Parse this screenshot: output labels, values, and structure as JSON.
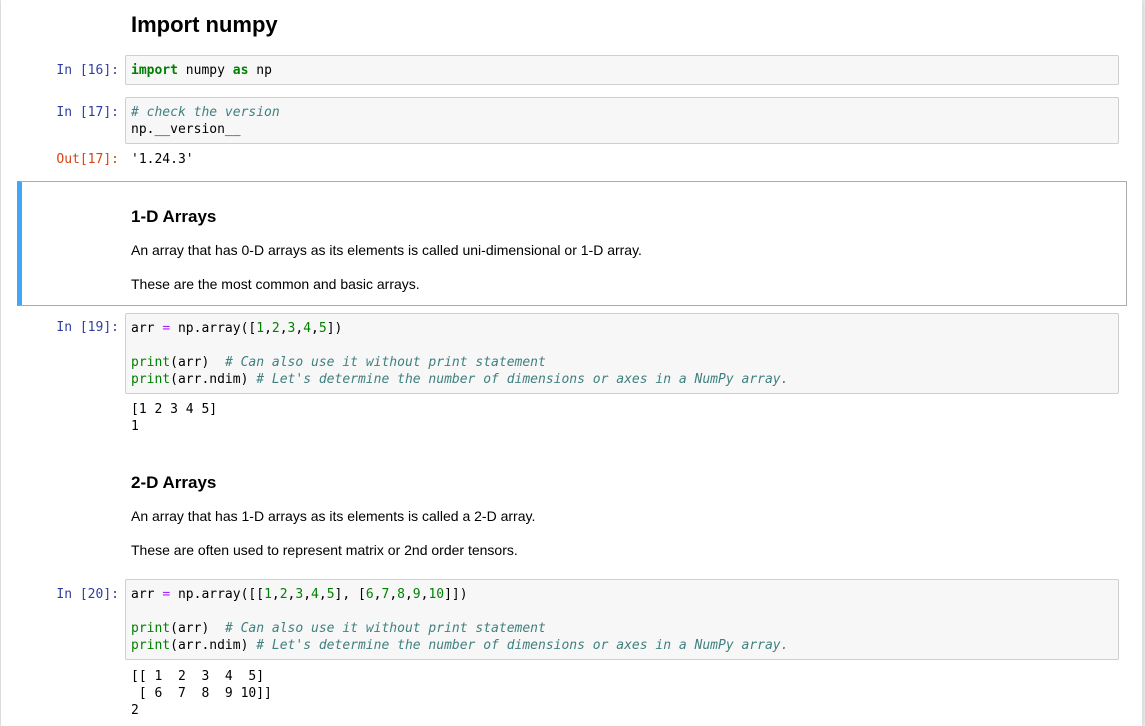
{
  "headings": {
    "import_numpy": "Import numpy",
    "arrays_1d": "1-D Arrays",
    "arrays_2d": "2-D Arrays"
  },
  "paragraphs": {
    "p1d_1": "An array that has 0-D arrays as its elements is called uni-dimensional or 1-D array.",
    "p1d_2": "These are the most common and basic arrays.",
    "p2d_1": "An array that has 1-D arrays as its elements is called a 2-D array.",
    "p2d_2": "These are often used to represent matrix or 2nd order tensors."
  },
  "prompts": {
    "in16": "In [16]:",
    "in17": "In [17]:",
    "out17": "Out[17]:",
    "in19": "In [19]:",
    "in20": "In [20]:"
  },
  "cell16": {
    "kw_import": "import",
    "mod": " numpy ",
    "kw_as": "as",
    "alias": " np"
  },
  "cell17": {
    "comment": "# check the version",
    "code": "np.__version__"
  },
  "out17": {
    "value": "'1.24.3'"
  },
  "cell19": {
    "arr": "arr ",
    "eq": "=",
    "call": " np.array([",
    "n1": "1",
    "n2": "2",
    "n3": "3",
    "n4": "4",
    "n5": "5",
    "comma": ",",
    "close": "])",
    "print_kw": "print",
    "p1_arg": "(arr)  ",
    "p1_comment": "# Can also use it without print statement",
    "p2_arg": "(arr.ndim) ",
    "p2_comment": "# Let's determine the number of dimensions or axes in a NumPy array.",
    "out_line1": "[1 2 3 4 5]",
    "out_line2": "1"
  },
  "cell20": {
    "arr": "arr ",
    "eq": "=",
    "open": " np.array([[",
    "a1": "1",
    "a2": "2",
    "a3": "3",
    "a4": "4",
    "a5": "5",
    "b1": "6",
    "b2": "7",
    "b3": "8",
    "b4": "9",
    "b5": "10",
    "comma": ",",
    "mid": "], [",
    "close": "]])",
    "print_kw": "print",
    "p1_arg": "(arr)  ",
    "p1_comment": "# Can also use it without print statement",
    "p2_arg": "(arr.ndim) ",
    "p2_comment": "# Let's determine the number of dimensions or axes in a NumPy array.",
    "out_line1": "[[ 1  2  3  4  5]",
    "out_line2": " [ 6  7  8  9 10]]",
    "out_line3": "2"
  }
}
